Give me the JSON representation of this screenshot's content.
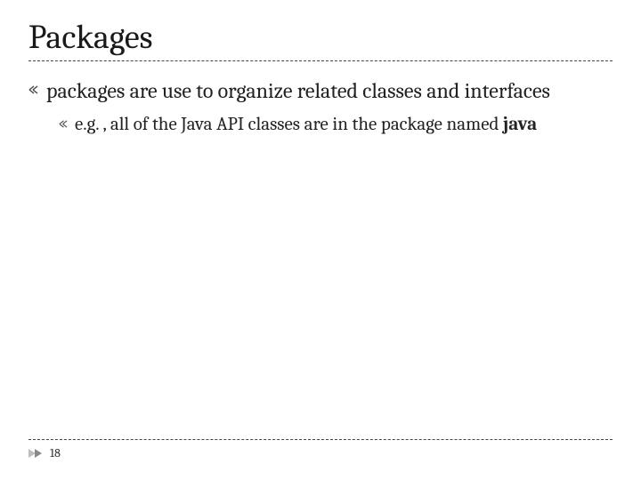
{
  "title": "Packages",
  "bullets": [
    {
      "text": "packages are use to organize related classes and interfaces",
      "sub": [
        {
          "text": "e.g. , all of the Java API classes are in the package named ",
          "bold": "java"
        }
      ]
    }
  ],
  "pageNumber": "18",
  "icons": {
    "bullet": "bullet-glyph",
    "subbullet": "subbullet-glyph",
    "decorator": "triangle-decorator"
  }
}
